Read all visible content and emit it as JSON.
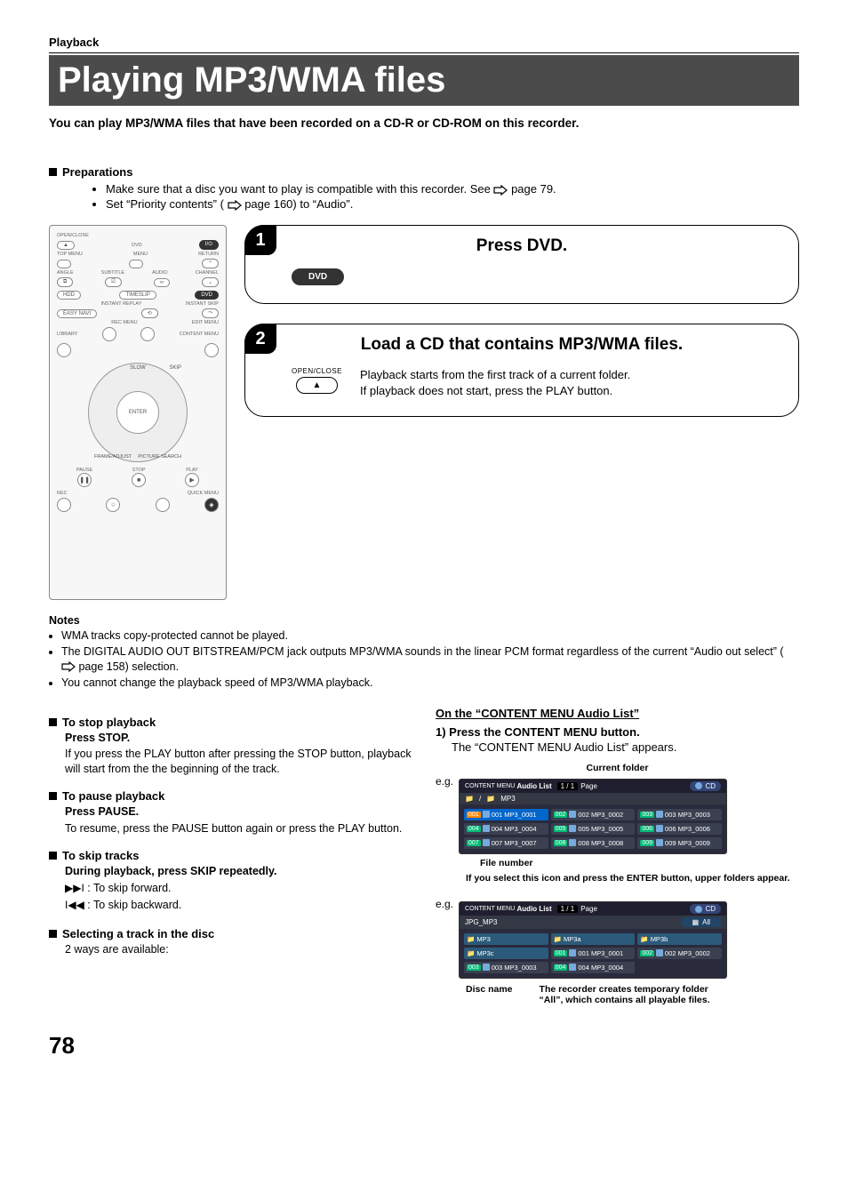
{
  "header": {
    "section": "Playback"
  },
  "title": "Playing MP3/WMA files",
  "intro": "You can play MP3/WMA files that have been recorded on a CD-R or CD-ROM on this recorder.",
  "prep": {
    "heading": "Preparations",
    "items": [
      {
        "pre": "Make sure that a disc you want to play is compatible with this recorder. See ",
        "ref": "page 79."
      },
      {
        "pre": "Set “Priority contents” (",
        "ref": "page 160) to “Audio”."
      }
    ]
  },
  "remote": {
    "openclose": "OPEN/CLOSE",
    "dvd": "DVD",
    "topmenu": "TOP MENU",
    "menu": "MENU",
    "return": "RETURN",
    "angle": "ANGLE",
    "subtitle": "SUBTITLE",
    "audio": "AUDIO",
    "channel": "CHANNEL",
    "hdd": "HDD",
    "timeslip": "TIMESLIP",
    "dvdbtn": "DVD",
    "instreplay": "INSTANT REPLAY",
    "instskip": "INSTANT SKIP",
    "easynavi": "EASY NAVI",
    "recmenu": "REC MENU",
    "editmenu": "EDIT MENU",
    "library": "LIBRARY",
    "contentmenu": "CONTENT MENU",
    "enter": "ENTER",
    "slow": "SLOW",
    "skip": "SKIP",
    "frame": "FRAME",
    "adjust": "ADJUST",
    "picture": "PICTURE",
    "search": "SEARCH",
    "pause": "PAUSE",
    "stop": "STOP",
    "play": "PLAY",
    "rec": "REC",
    "quickmenu": "QUICK MENU"
  },
  "steps": {
    "s1": {
      "title": "Press DVD.",
      "btn": "DVD"
    },
    "s2": {
      "title": "Load a CD that contains MP3/WMA files.",
      "note1": "Playback starts from the first track of a current folder.",
      "note2": "If playback does not start, press the PLAY button.",
      "btn_top": "OPEN/CLOSE"
    }
  },
  "notes": {
    "heading": "Notes",
    "items": [
      "WMA tracks copy-protected cannot be played.",
      {
        "pre": "The DIGITAL AUDIO OUT BITSTREAM/PCM jack outputs MP3/WMA sounds in the linear PCM format regardless of the current “Audio out select” (",
        "ref": "page 158) selection."
      },
      "You cannot change the playback speed of MP3/WMA playback."
    ]
  },
  "left": {
    "stop_h": "To stop playback",
    "stop_b1": "Press STOP.",
    "stop_b2": "If you press the PLAY button after pressing the STOP button, playback will start from the the beginning of the track.",
    "pause_h": "To pause playback",
    "pause_b1": "Press PAUSE.",
    "pause_b2": "To resume, press the PAUSE button again or press the PLAY button.",
    "skip_h": "To skip tracks",
    "skip_b1": "During playback, press SKIP repeatedly.",
    "skip_fwd": ": To skip forward.",
    "skip_bwd": ": To skip backward.",
    "sel_h": "Selecting a track in the disc",
    "sel_b": "2 ways are available:"
  },
  "right": {
    "title": "On the “CONTENT MENU Audio List”",
    "s1": "1)  Press the CONTENT MENU button.",
    "s1b": "The “CONTENT MENU Audio List” appears.",
    "eg": "e.g.",
    "cap_current": "Current folder",
    "cap_filenum": "File number",
    "cap_upper": "If you select this icon and press the ENTER button, upper folders appear.",
    "cap_disc": "Disc name",
    "cap_all": "The recorder creates temporary folder “All”, which contains all playable files.",
    "ss1": {
      "menu": "CONTENT MENU",
      "title": "Audio List",
      "page": "1 / 1",
      "page_lbl": "Page",
      "disc": "CD",
      "crumb_root": "/",
      "crumb_folder": "MP3",
      "cells": [
        "001 MP3_0001",
        "002 MP3_0002",
        "003 MP3_0003",
        "004 MP3_0004",
        "005 MP3_0005",
        "006 MP3_0006",
        "007 MP3_0007",
        "008 MP3_0008",
        "009 MP3_0009"
      ]
    },
    "ss2": {
      "menu": "CONTENT MENU",
      "title": "Audio List",
      "page": "1 / 1",
      "page_lbl": "Page",
      "disc": "CD",
      "crumb": "JPG_MP3",
      "all": "All",
      "folders": [
        "MP3",
        "MP3a",
        "MP3b",
        "MP3c"
      ],
      "cells": [
        "001 MP3_0001",
        "002 MP3_0002",
        "003 MP3_0003",
        "004 MP3_0004"
      ]
    }
  },
  "page_number": "78"
}
